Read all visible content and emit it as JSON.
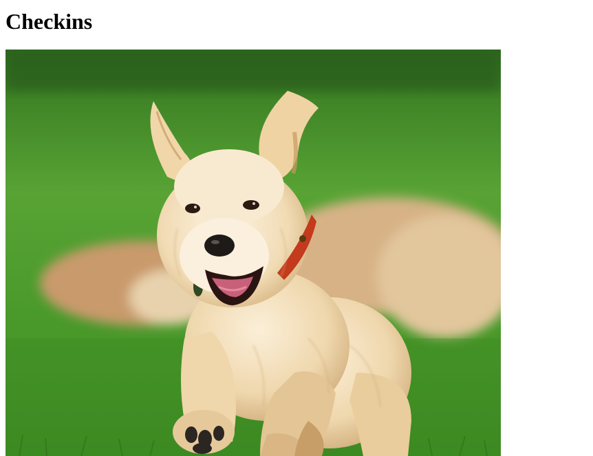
{
  "page": {
    "title": "Checkins"
  },
  "photo": {
    "subject": "puppy-photo",
    "colors": {
      "grass": "#4f9a2e",
      "grass_dark": "#2f6e1c",
      "fur": "#f0dcb8",
      "fur_shadow": "#c9a97a",
      "rock": "#d7b58d"
    }
  }
}
